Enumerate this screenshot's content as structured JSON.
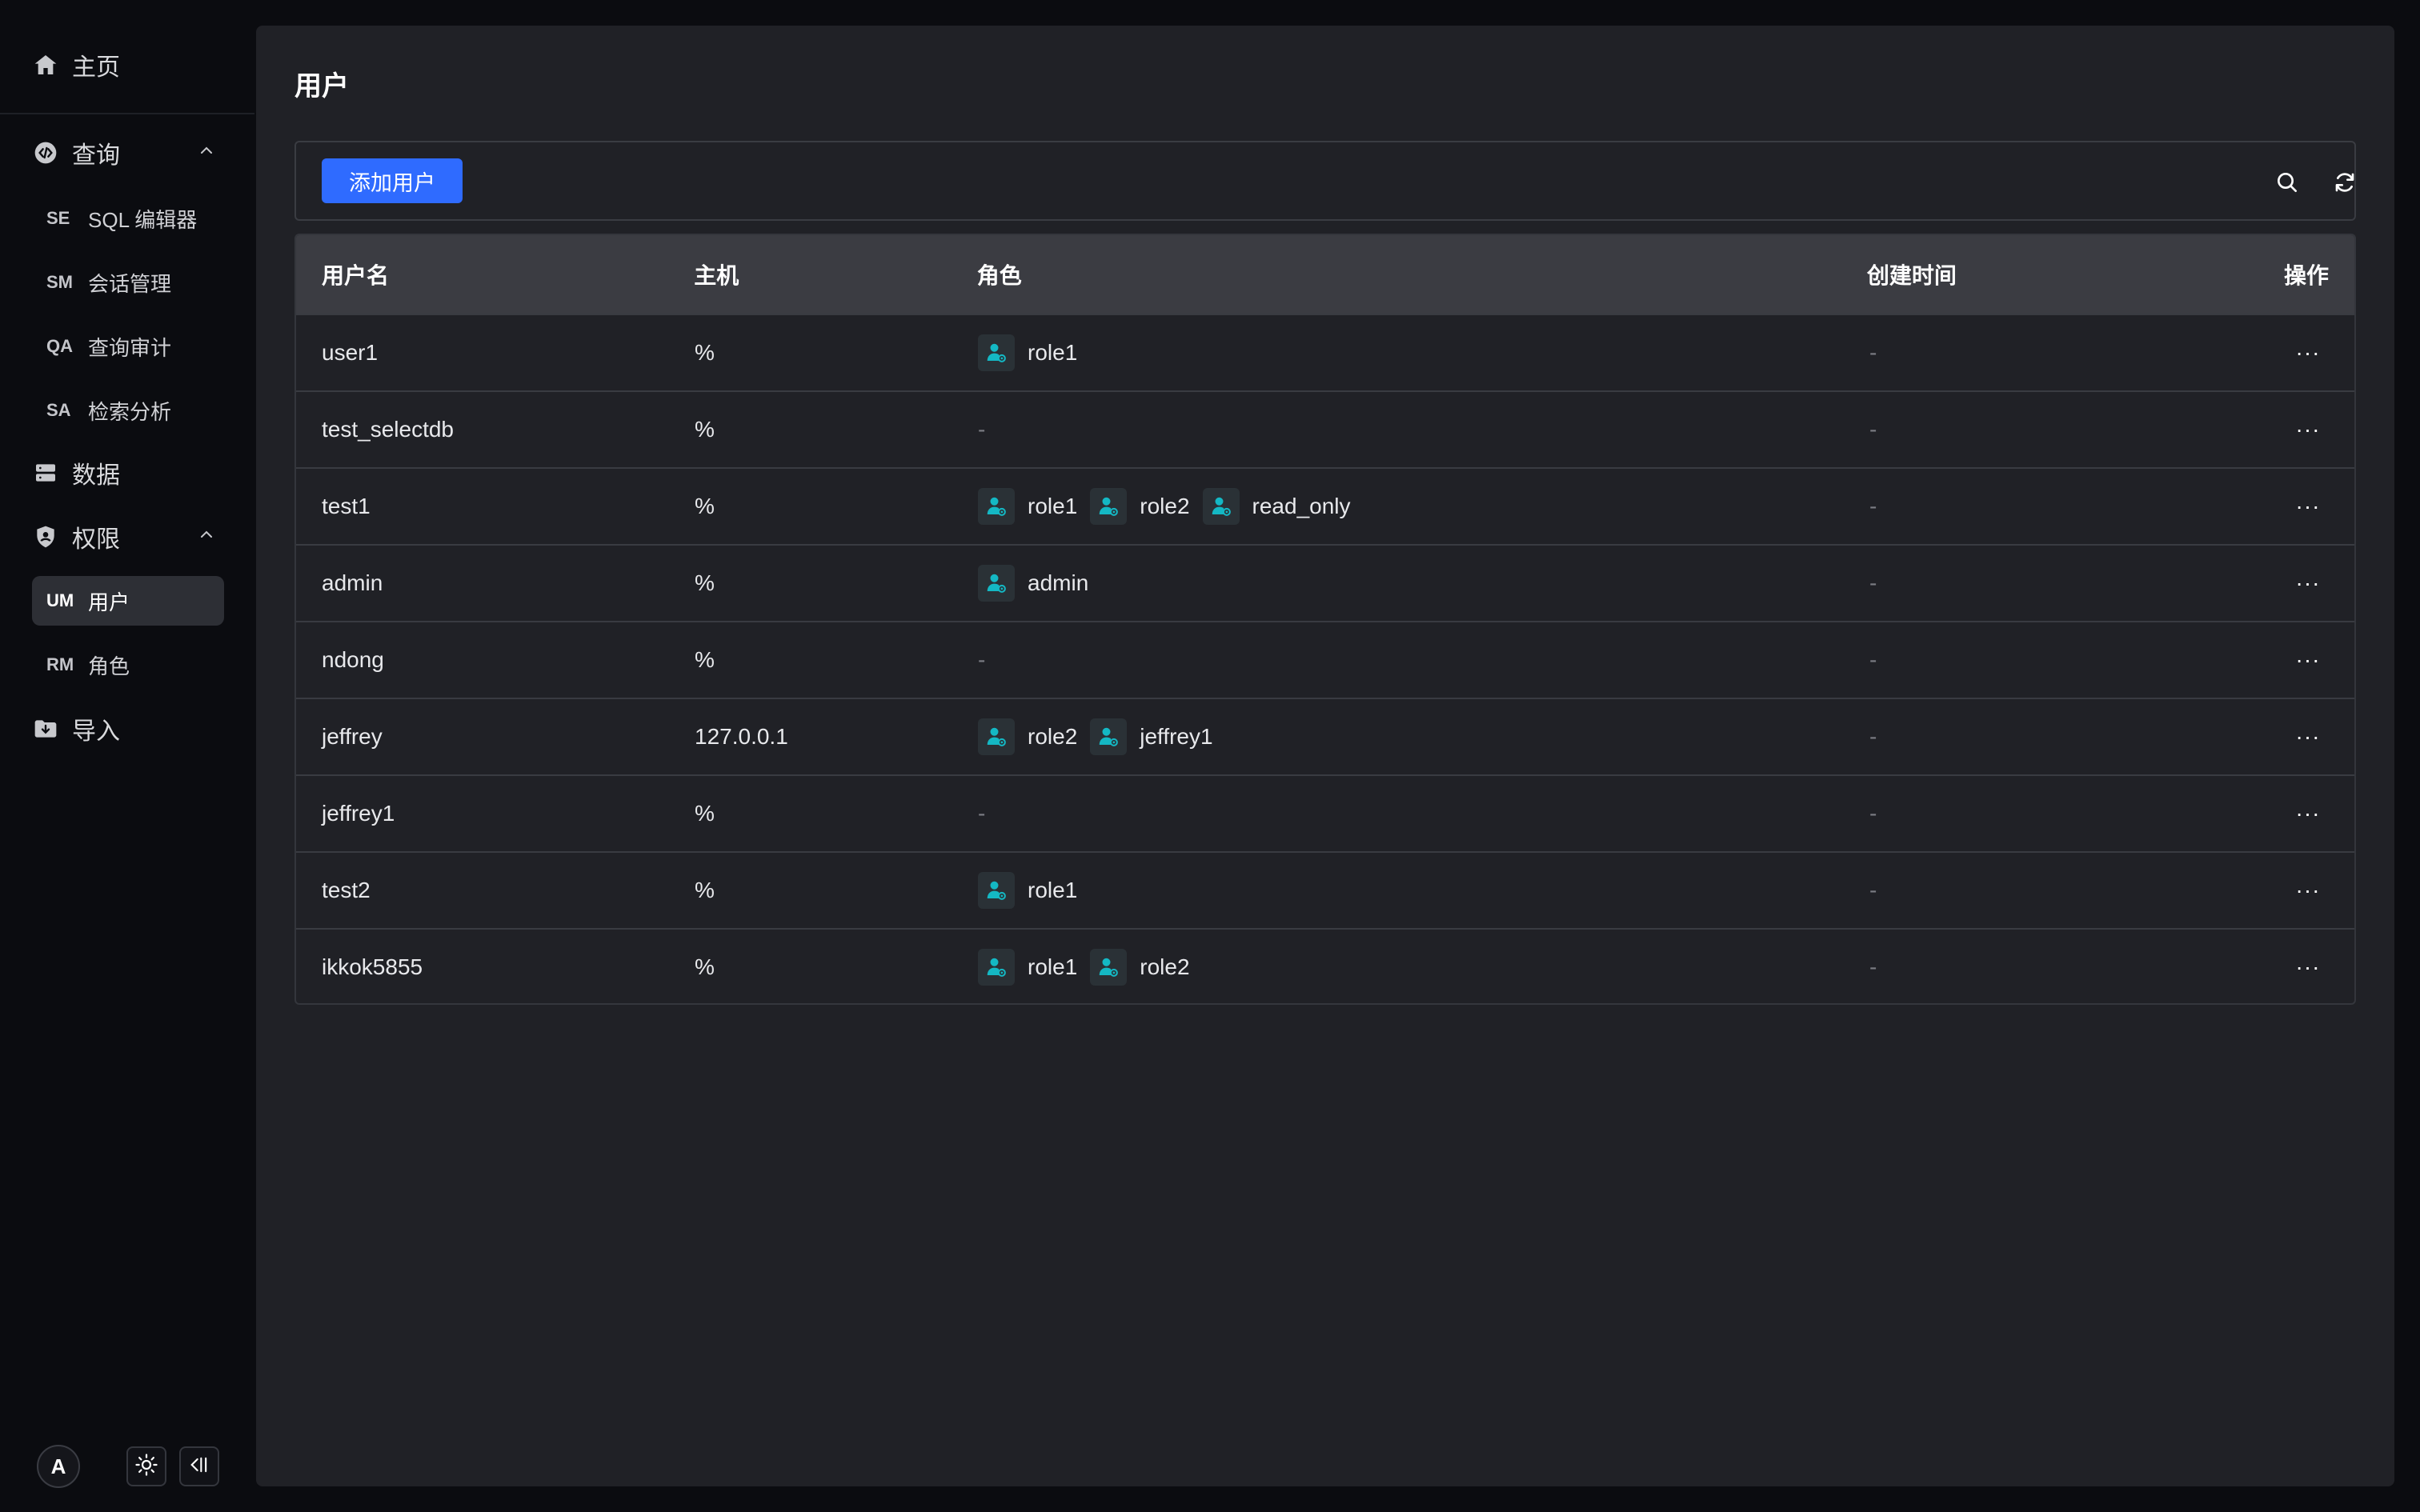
{
  "sidebar": {
    "home": {
      "label": "主页",
      "icon": "home-icon"
    },
    "groups": {
      "query": {
        "label": "查询",
        "icon": "query-code-icon"
      },
      "permission": {
        "label": "权限",
        "icon": "shield-icon"
      }
    },
    "items": {
      "sql_editor": {
        "abbr": "SE",
        "label": "SQL 编辑器"
      },
      "session": {
        "abbr": "SM",
        "label": "会话管理"
      },
      "audit": {
        "abbr": "QA",
        "label": "查询审计"
      },
      "search": {
        "abbr": "SA",
        "label": "检索分析"
      },
      "data": {
        "label": "数据",
        "icon": "database-icon"
      },
      "users": {
        "abbr": "UM",
        "label": "用户"
      },
      "roles": {
        "abbr": "RM",
        "label": "角色"
      },
      "import": {
        "label": "导入",
        "icon": "folder-import-icon"
      }
    },
    "bottom": {
      "avatar": "A"
    }
  },
  "page": {
    "title": "用户",
    "add_button": "添加用户"
  },
  "table": {
    "columns": {
      "username": "用户名",
      "host": "主机",
      "roles": "角色",
      "created": "创建时间",
      "actions": "操作"
    },
    "rows": [
      {
        "username": "user1",
        "host": "%",
        "roles": [
          "role1"
        ],
        "created": "-"
      },
      {
        "username": "test_selectdb",
        "host": "%",
        "roles": [],
        "created": "-"
      },
      {
        "username": "test1",
        "host": "%",
        "roles": [
          "role1",
          "role2",
          "read_only"
        ],
        "created": "-"
      },
      {
        "username": "admin",
        "host": "%",
        "roles": [
          "admin"
        ],
        "created": "-"
      },
      {
        "username": "ndong",
        "host": "%",
        "roles": [],
        "created": "-"
      },
      {
        "username": "jeffrey",
        "host": "127.0.0.1",
        "roles": [
          "role2",
          "jeffrey1"
        ],
        "created": "-"
      },
      {
        "username": "jeffrey1",
        "host": "%",
        "roles": [],
        "created": "-"
      },
      {
        "username": "test2",
        "host": "%",
        "roles": [
          "role1"
        ],
        "created": "-"
      },
      {
        "username": "ikkok5855",
        "host": "%",
        "roles": [
          "role1",
          "role2"
        ],
        "created": "-"
      }
    ],
    "empty_placeholder": "-",
    "more_glyph": "···"
  },
  "colors": {
    "accent": "#2f6bff",
    "role_icon": "#14b8c4"
  }
}
